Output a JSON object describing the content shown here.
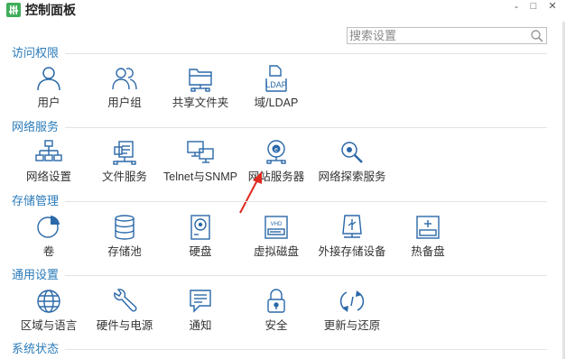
{
  "window": {
    "title": "控制面板",
    "minimize": "-",
    "maximize": "□",
    "close": "✕"
  },
  "search": {
    "placeholder": "搜索设置",
    "icon": "search-icon"
  },
  "colors": {
    "section": "#2b7bb9",
    "icon": "#2a68a8",
    "arrow": "#e02a1f",
    "accent": "#3fae5a"
  },
  "sections": [
    {
      "title": "访问权限",
      "items": [
        {
          "label": "用户",
          "icon": "user-icon"
        },
        {
          "label": "用户组",
          "icon": "user-group-icon"
        },
        {
          "label": "共享文件夹",
          "icon": "shared-folder-icon"
        },
        {
          "label": "域/LDAP",
          "icon": "ldap-icon",
          "icon_text": "LDAP"
        }
      ]
    },
    {
      "title": "网络服务",
      "items": [
        {
          "label": "网络设置",
          "icon": "network-icon"
        },
        {
          "label": "文件服务",
          "icon": "file-service-icon"
        },
        {
          "label": "Telnet与SNMP",
          "icon": "telnet-icon"
        },
        {
          "label": "网站服务器",
          "icon": "web-server-icon"
        },
        {
          "label": "网络探索服务",
          "icon": "network-discovery-icon"
        }
      ]
    },
    {
      "title": "存储管理",
      "items": [
        {
          "label": "卷",
          "icon": "volume-icon"
        },
        {
          "label": "存储池",
          "icon": "storage-pool-icon"
        },
        {
          "label": "硬盘",
          "icon": "hard-disk-icon"
        },
        {
          "label": "虚拟磁盘",
          "icon": "virtual-disk-icon",
          "icon_text": "VHD"
        },
        {
          "label": "外接存储设备",
          "icon": "usb-storage-icon"
        },
        {
          "label": "热备盘",
          "icon": "hot-spare-icon"
        }
      ]
    },
    {
      "title": "通用设置",
      "items": [
        {
          "label": "区域与语言",
          "icon": "globe-icon"
        },
        {
          "label": "硬件与电源",
          "icon": "wrench-icon"
        },
        {
          "label": "通知",
          "icon": "notification-icon"
        },
        {
          "label": "安全",
          "icon": "lock-icon"
        },
        {
          "label": "更新与还原",
          "icon": "refresh-icon"
        }
      ]
    },
    {
      "title": "系统状态",
      "items": []
    }
  ]
}
